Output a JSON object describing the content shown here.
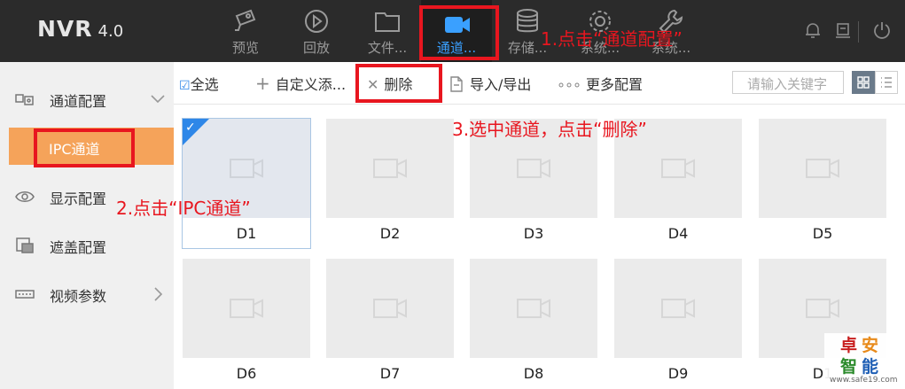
{
  "header": {
    "logo": "NVR",
    "version": "4.0",
    "nav": [
      {
        "label": "预览",
        "icon": "camera-icon"
      },
      {
        "label": "回放",
        "icon": "playback-icon"
      },
      {
        "label": "文件...",
        "icon": "folder-icon"
      },
      {
        "label": "通道...",
        "icon": "video-camera-icon",
        "active": true
      },
      {
        "label": "存储...",
        "icon": "database-icon"
      },
      {
        "label": "系统...",
        "icon": "gear-icon"
      },
      {
        "label": "系统...",
        "icon": "wrench-icon"
      }
    ]
  },
  "sidebar": {
    "items": [
      {
        "label": "通道配置",
        "icon": "channel-config-icon"
      },
      {
        "label": "IPC通道"
      },
      {
        "label": "显示配置",
        "icon": "eye-icon"
      },
      {
        "label": "遮盖配置",
        "icon": "mask-icon"
      },
      {
        "label": "视频参数",
        "icon": "video-param-icon"
      }
    ]
  },
  "toolbar": {
    "select_all": "全选",
    "add": "自定义添...",
    "delete": "删除",
    "import_export": "导入/导出",
    "more": "更多配置",
    "search_placeholder": "请输入关键字"
  },
  "channels": [
    {
      "label": "D1",
      "selected": true
    },
    {
      "label": "D2"
    },
    {
      "label": "D3"
    },
    {
      "label": "D4"
    },
    {
      "label": "D5"
    },
    {
      "label": "D6"
    },
    {
      "label": "D7"
    },
    {
      "label": "D8"
    },
    {
      "label": "D9"
    },
    {
      "label": "D1"
    }
  ],
  "annotations": {
    "step1": "1.点击“通道配置”",
    "step2": "2.点击“IPC通道”",
    "step3": "3.选中通道，点击“删除”"
  },
  "watermark": {
    "brand": "卓安智能",
    "url": "www.safe19.com"
  },
  "colors": {
    "topbar": "#2b2b2b",
    "accent_blue": "#3aa0ff",
    "active_submenu": "#f5a35a",
    "annotation_red": "#e8161f"
  }
}
